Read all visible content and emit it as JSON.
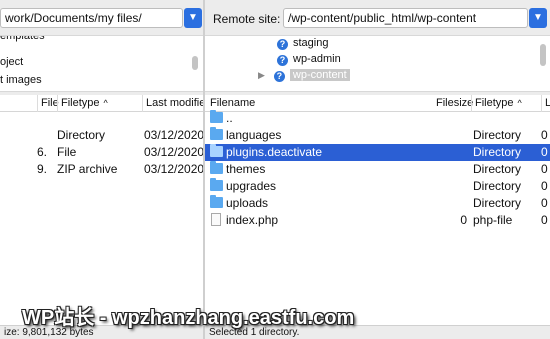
{
  "local": {
    "path": "work/Documents/my files/",
    "tree_items": [
      "emplates",
      "oject",
      "t images"
    ],
    "headers": [
      "File",
      "Filetype",
      "Last modifie"
    ],
    "rows": [
      {
        "name": "",
        "size": "",
        "type": "Directory",
        "modified": "03/12/2020"
      },
      {
        "name": "",
        "size": "6.",
        "type": "File",
        "modified": "03/12/2020"
      },
      {
        "name": "",
        "size": "9.",
        "type": "ZIP archive",
        "modified": "03/12/2020"
      }
    ],
    "status": "ize: 9,801,132 bytes"
  },
  "remote": {
    "label": "Remote site:",
    "path": "/wp-content/public_html/wp-content",
    "tree_items": [
      {
        "label": "staging",
        "icon": "question-folder-icon"
      },
      {
        "label": "wp-admin",
        "icon": "question-folder-icon"
      },
      {
        "label": "wp-content",
        "icon": "question-folder-icon",
        "selected": true
      }
    ],
    "headers": [
      "Filename",
      "Filesize",
      "Filetype",
      "L"
    ],
    "rows": [
      {
        "name": "..",
        "size": "",
        "type": "",
        "extra": "",
        "icon": "folder-icon"
      },
      {
        "name": "languages",
        "size": "",
        "type": "Directory",
        "extra": "0",
        "icon": "folder-icon"
      },
      {
        "name": "plugins.deactivate",
        "size": "",
        "type": "Directory",
        "extra": "0",
        "icon": "folder-icon",
        "selected": true
      },
      {
        "name": "themes",
        "size": "",
        "type": "Directory",
        "extra": "0",
        "icon": "folder-icon"
      },
      {
        "name": "upgrades",
        "size": "",
        "type": "Directory",
        "extra": "0",
        "icon": "folder-icon"
      },
      {
        "name": "uploads",
        "size": "",
        "type": "Directory",
        "extra": "0",
        "icon": "folder-icon"
      },
      {
        "name": "index.php",
        "size": "0",
        "type": "php-file",
        "extra": "0",
        "icon": "file-icon"
      }
    ],
    "status": "Selected 1 directory."
  },
  "watermark": "WP站长 - wpzhanzhang.eastfu.com",
  "colors": {
    "selection": "#2b5fd4",
    "dropdown": "#2b6fe0",
    "folder": "#5aa9f0"
  }
}
